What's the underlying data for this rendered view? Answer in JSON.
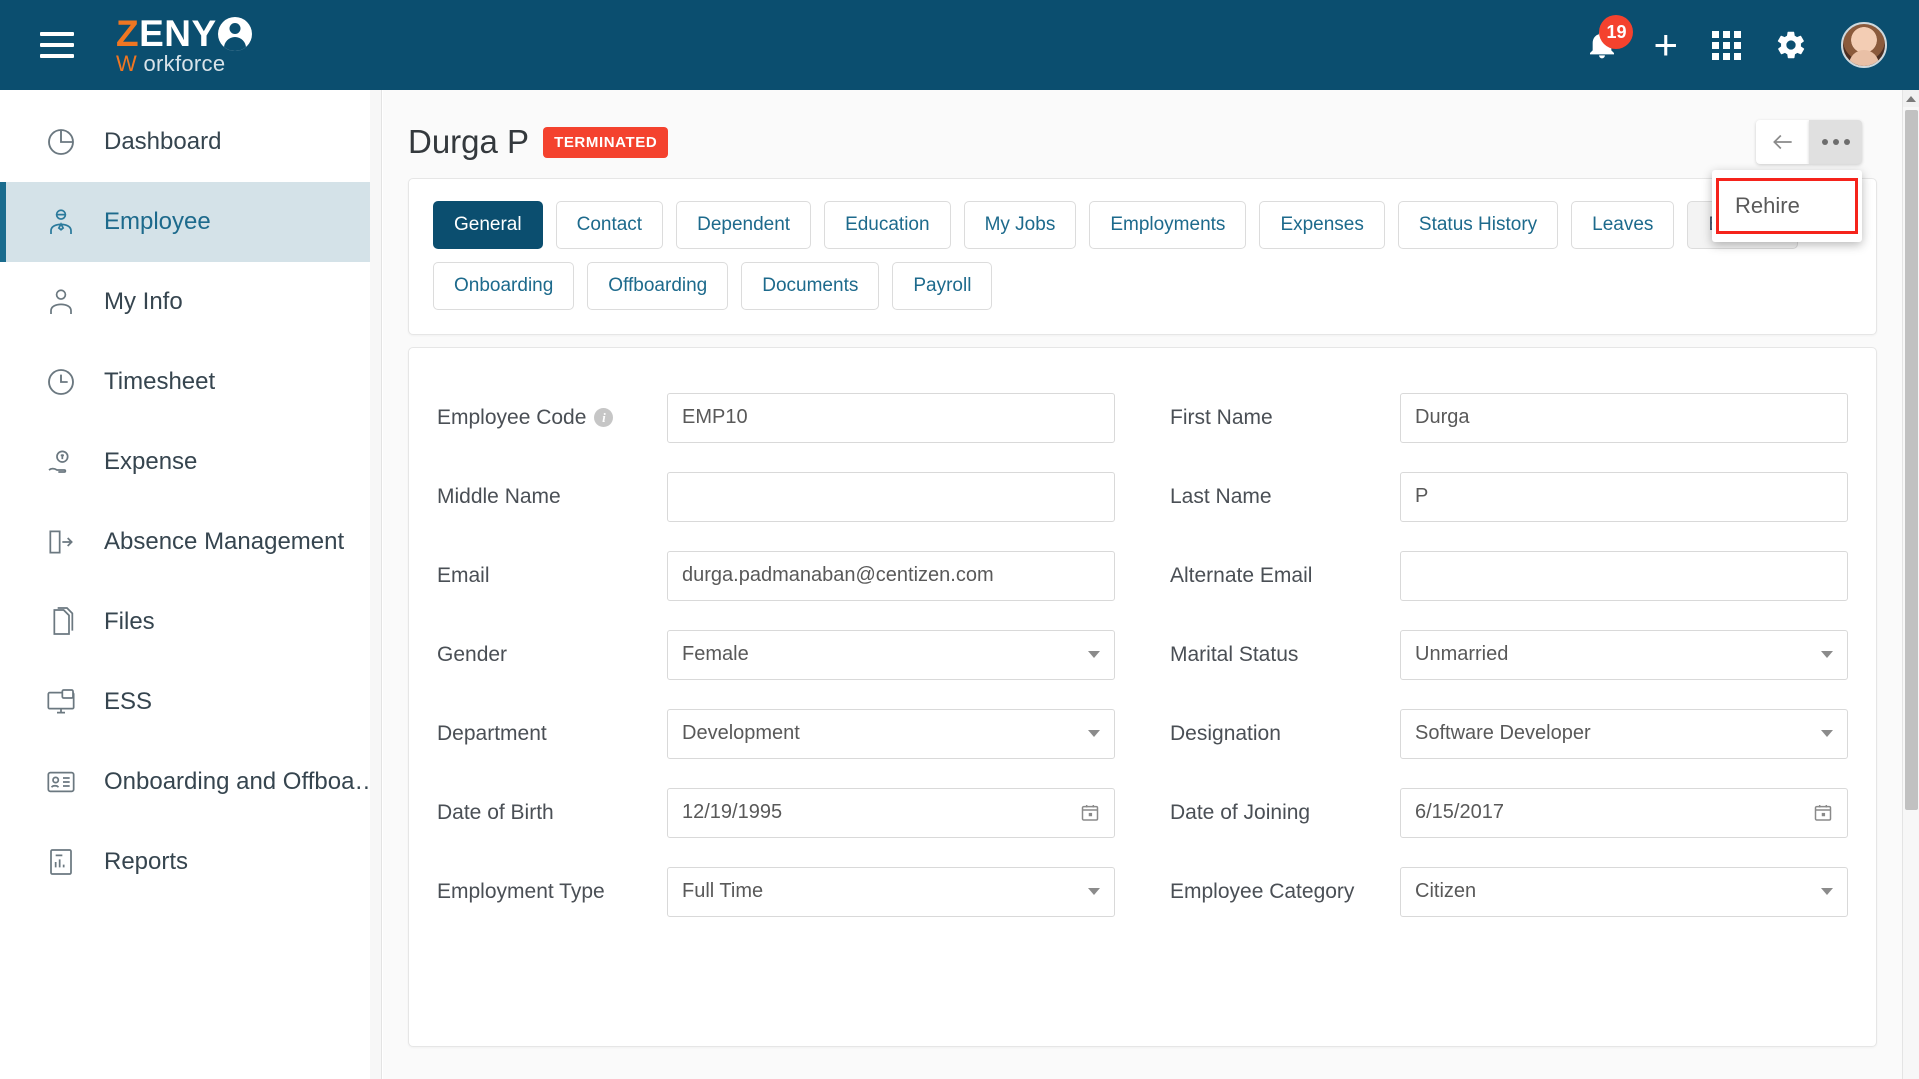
{
  "brand": {
    "z": "Z",
    "eny": "ENY",
    "w": "W",
    "orkforce": "orkforce",
    "globe_icon": "person-globe-icon"
  },
  "topbar": {
    "menu_icon": "hamburger-menu-icon",
    "notification_count": "19",
    "add_label": "+",
    "apps_icon": "apps-grid-icon",
    "settings_icon": "gear-icon",
    "avatar_icon": "user-avatar"
  },
  "sidebar": {
    "items": [
      {
        "label": "Dashboard",
        "icon": "pie-chart-icon",
        "active": false
      },
      {
        "label": "Employee",
        "icon": "employee-icon",
        "active": true
      },
      {
        "label": "My Info",
        "icon": "user-info-icon",
        "active": false
      },
      {
        "label": "Timesheet",
        "icon": "clock-icon",
        "active": false
      },
      {
        "label": "Expense",
        "icon": "money-hand-icon",
        "active": false
      },
      {
        "label": "Absence Management",
        "icon": "exit-door-icon",
        "active": false
      },
      {
        "label": "Files",
        "icon": "files-icon",
        "active": false
      },
      {
        "label": "ESS",
        "icon": "monitor-chat-icon",
        "active": false
      },
      {
        "label": "Onboarding and Offboardi...",
        "icon": "id-card-icon",
        "active": false
      },
      {
        "label": "Reports",
        "icon": "report-chart-icon",
        "active": false
      }
    ]
  },
  "page": {
    "title": "Durga P",
    "status_badge": "TERMINATED",
    "back_icon": "back-arrow-icon",
    "more_icon": "ellipsis-icon"
  },
  "dropdown": {
    "items": [
      {
        "label": "Rehire"
      }
    ]
  },
  "tabs": {
    "row1": [
      {
        "label": "General",
        "active": true
      },
      {
        "label": "Contact",
        "active": false
      },
      {
        "label": "Dependent",
        "active": false
      },
      {
        "label": "Education",
        "active": false
      },
      {
        "label": "My Jobs",
        "active": false
      },
      {
        "label": "Employments",
        "active": false
      },
      {
        "label": "Expenses",
        "active": false
      },
      {
        "label": "Status History",
        "active": false
      },
      {
        "label": "Leaves",
        "active": false
      },
      {
        "label": "Benefits",
        "active": false
      }
    ],
    "row2": [
      {
        "label": "Onboarding",
        "active": false
      },
      {
        "label": "Offboarding",
        "active": false
      },
      {
        "label": "Documents",
        "active": false
      },
      {
        "label": "Payroll",
        "active": false
      }
    ]
  },
  "form": {
    "fields": [
      {
        "label": "Employee Code",
        "value": "EMP10",
        "type": "text",
        "info": true
      },
      {
        "label": "First Name",
        "value": "Durga",
        "type": "text"
      },
      {
        "label": "Middle Name",
        "value": "",
        "type": "text"
      },
      {
        "label": "Last Name",
        "value": "P",
        "type": "text"
      },
      {
        "label": "Email",
        "value": "durga.padmanaban@centizen.com",
        "type": "text"
      },
      {
        "label": "Alternate Email",
        "value": "",
        "type": "text"
      },
      {
        "label": "Gender",
        "value": "Female",
        "type": "select"
      },
      {
        "label": "Marital Status",
        "value": "Unmarried",
        "type": "select"
      },
      {
        "label": "Department",
        "value": "Development",
        "type": "select"
      },
      {
        "label": "Designation",
        "value": "Software Developer",
        "type": "select"
      },
      {
        "label": "Date of Birth",
        "value": "12/19/1995",
        "type": "date"
      },
      {
        "label": "Date of Joining",
        "value": "6/15/2017",
        "type": "date"
      },
      {
        "label": "Employment Type",
        "value": "Full Time",
        "type": "select"
      },
      {
        "label": "Employee Category",
        "value": "Citizen",
        "type": "select"
      }
    ]
  },
  "colors": {
    "brand_dark": "#0b4e6f",
    "brand_orange": "#ef7622",
    "accent_link": "#1d6a8c",
    "danger": "#f4422e",
    "highlight_border": "#f5231b",
    "sidebar_active_bg": "#d4e2e8"
  }
}
